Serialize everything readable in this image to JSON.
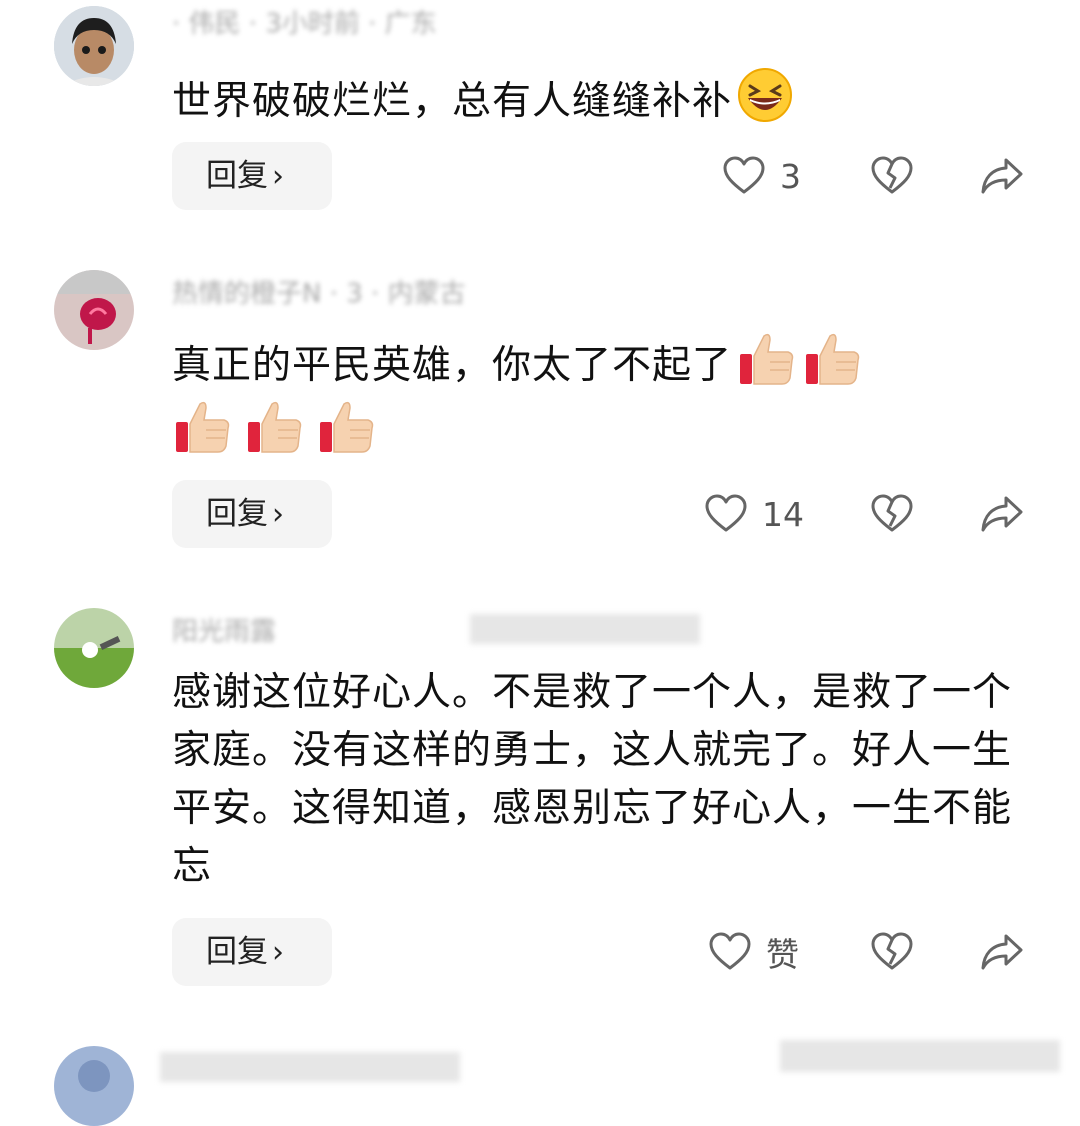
{
  "comments": [
    {
      "meta": "· 伟民 · 3小时前 · 广东",
      "text": "世界破破烂烂，总有人缝缝补补",
      "reply_label": "回复",
      "like_count": "3"
    },
    {
      "meta": "热情的橙子N · 3 · 内蒙古",
      "text": "真正的平民英雄，你太了不起了",
      "reply_label": "回复",
      "like_count": "14"
    },
    {
      "meta": "阳光雨露",
      "text": "感谢这位好心人。不是救了一个人，是救了一个家庭。没有这样的勇士，这人就完了。好人一生平安。这得知道，感恩别忘了好心人，一生不能忘",
      "reply_label": "回复",
      "like_count": "赞"
    }
  ],
  "icons": {
    "like": "heart-outline-icon",
    "dislike": "broken-heart-icon",
    "share": "share-arrow-icon",
    "laugh_emoji": "grinning-squinting-face-icon",
    "thumbs_up_emoji": "thumbs-up-icon"
  },
  "colors": {
    "reply_bg": "#f4f4f4",
    "icon_gray": "#666666",
    "text": "#111111"
  }
}
